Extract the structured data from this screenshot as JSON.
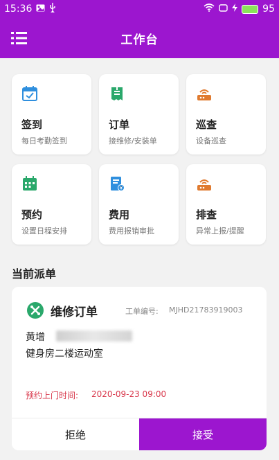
{
  "status_bar": {
    "time": "15:36",
    "battery": "95",
    "icons": [
      "image-icon",
      "usb-icon",
      "wifi-icon",
      "rotate-icon",
      "charging-icon",
      "battery-icon"
    ]
  },
  "header": {
    "title": "工作台",
    "menu_icon": "menu-icon",
    "background_color": "#9c16cf"
  },
  "tiles": [
    {
      "label": "签到",
      "sub": "每日考勤签到",
      "icon": "calendar-check-icon",
      "color": "#2f8fde"
    },
    {
      "label": "订单",
      "sub": "接维修/安装单",
      "icon": "order-icon",
      "color": "#2aa86b"
    },
    {
      "label": "巡查",
      "sub": "设备巡查",
      "icon": "router-icon",
      "color": "#e07a2f"
    },
    {
      "label": "预约",
      "sub": "设置日程安排",
      "icon": "calendar-icon",
      "color": "#2aa86b"
    },
    {
      "label": "费用",
      "sub": "费用报销审批",
      "icon": "expense-icon",
      "color": "#2f8fde"
    },
    {
      "label": "排查",
      "sub": "异常上报/提醒",
      "icon": "router-icon",
      "color": "#e07a2f"
    }
  ],
  "section": {
    "title": "当前派单"
  },
  "order": {
    "title": "维修订单",
    "no_label": "工单编号:",
    "no": "MJHD21783919003",
    "person": "黄增",
    "place": "健身房二楼运动室",
    "appt_label": "预约上门时间:",
    "appt_time": "2020-09-23 09:00",
    "reject": "拒绝",
    "accept": "接受",
    "accent_color": "#9c16cf",
    "icon_color": "#2aa86b",
    "appt_color": "#d8364a"
  }
}
